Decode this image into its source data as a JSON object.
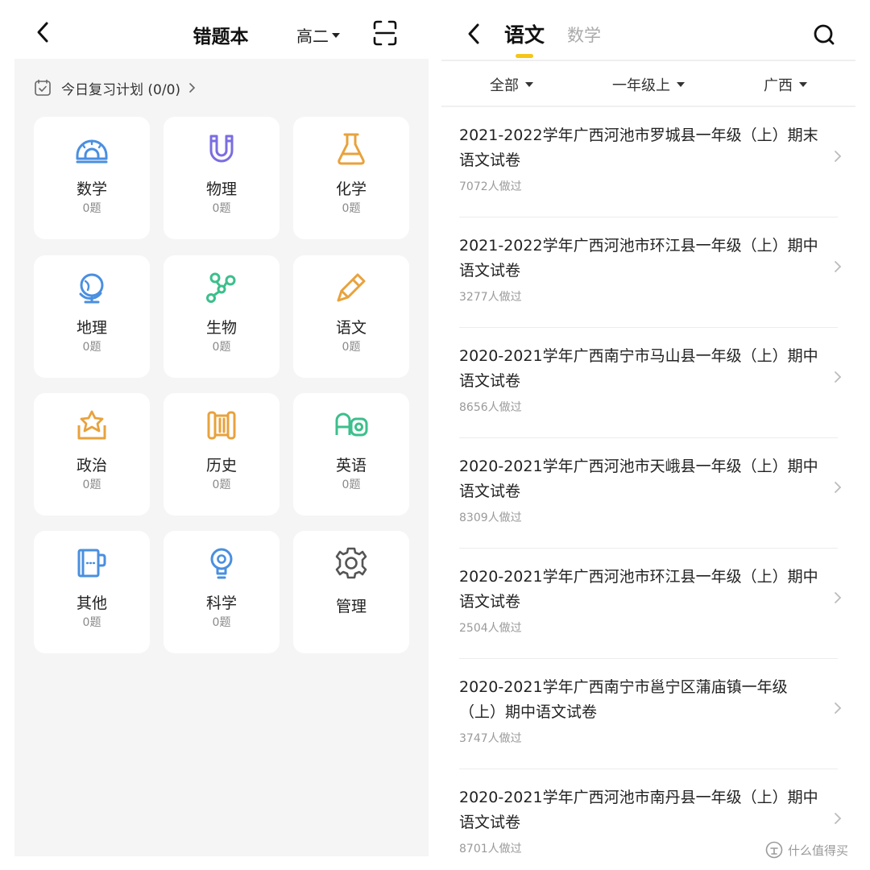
{
  "left": {
    "title": "错题本",
    "grade": "高二",
    "plan_label": "今日复习计划 (0/0)",
    "subjects": [
      {
        "name": "数学",
        "count": "0题",
        "icon": "protractor-icon",
        "color": "#4a8fe0"
      },
      {
        "name": "物理",
        "count": "0题",
        "icon": "magnet-icon",
        "color": "#7a6de0"
      },
      {
        "name": "化学",
        "count": "0题",
        "icon": "flask-icon",
        "color": "#e8a23c"
      },
      {
        "name": "地理",
        "count": "0题",
        "icon": "globe-icon",
        "color": "#4a8fe0"
      },
      {
        "name": "生物",
        "count": "0题",
        "icon": "molecule-icon",
        "color": "#3cbf8c"
      },
      {
        "name": "语文",
        "count": "0题",
        "icon": "brush-icon",
        "color": "#e8a23c"
      },
      {
        "name": "政治",
        "count": "0题",
        "icon": "star-book-icon",
        "color": "#e8a23c"
      },
      {
        "name": "历史",
        "count": "0题",
        "icon": "scroll-icon",
        "color": "#e8a23c"
      },
      {
        "name": "英语",
        "count": "0题",
        "icon": "letters-icon",
        "color": "#3cbf8c"
      },
      {
        "name": "其他",
        "count": "0题",
        "icon": "cup-book-icon",
        "color": "#4a8fe0"
      },
      {
        "name": "科学",
        "count": "0题",
        "icon": "bulb-icon",
        "color": "#4a8fe0"
      }
    ],
    "manage_label": "管理"
  },
  "right": {
    "tab_active": "语文",
    "tab_other": "数学",
    "filters": [
      "全部",
      "一年级上",
      "广西"
    ],
    "exams": [
      {
        "title": "2021-2022学年广西河池市罗城县一年级（上）期末语文试卷",
        "done": "7072人做过"
      },
      {
        "title": "2021-2022学年广西河池市环江县一年级（上）期中语文试卷",
        "done": "3277人做过"
      },
      {
        "title": "2020-2021学年广西南宁市马山县一年级（上）期中语文试卷",
        "done": "8656人做过"
      },
      {
        "title": "2020-2021学年广西河池市天峨县一年级（上）期中语文试卷",
        "done": "8309人做过"
      },
      {
        "title": "2020-2021学年广西河池市环江县一年级（上）期中语文试卷",
        "done": "2504人做过"
      },
      {
        "title": "2020-2021学年广西南宁市邕宁区蒲庙镇一年级（上）期中语文试卷",
        "done": "3747人做过"
      },
      {
        "title": "2020-2021学年广西河池市南丹县一年级（上）期中语文试卷",
        "done": "8701人做过"
      }
    ]
  },
  "accent": "#f5c518",
  "watermark": "什么值得买"
}
